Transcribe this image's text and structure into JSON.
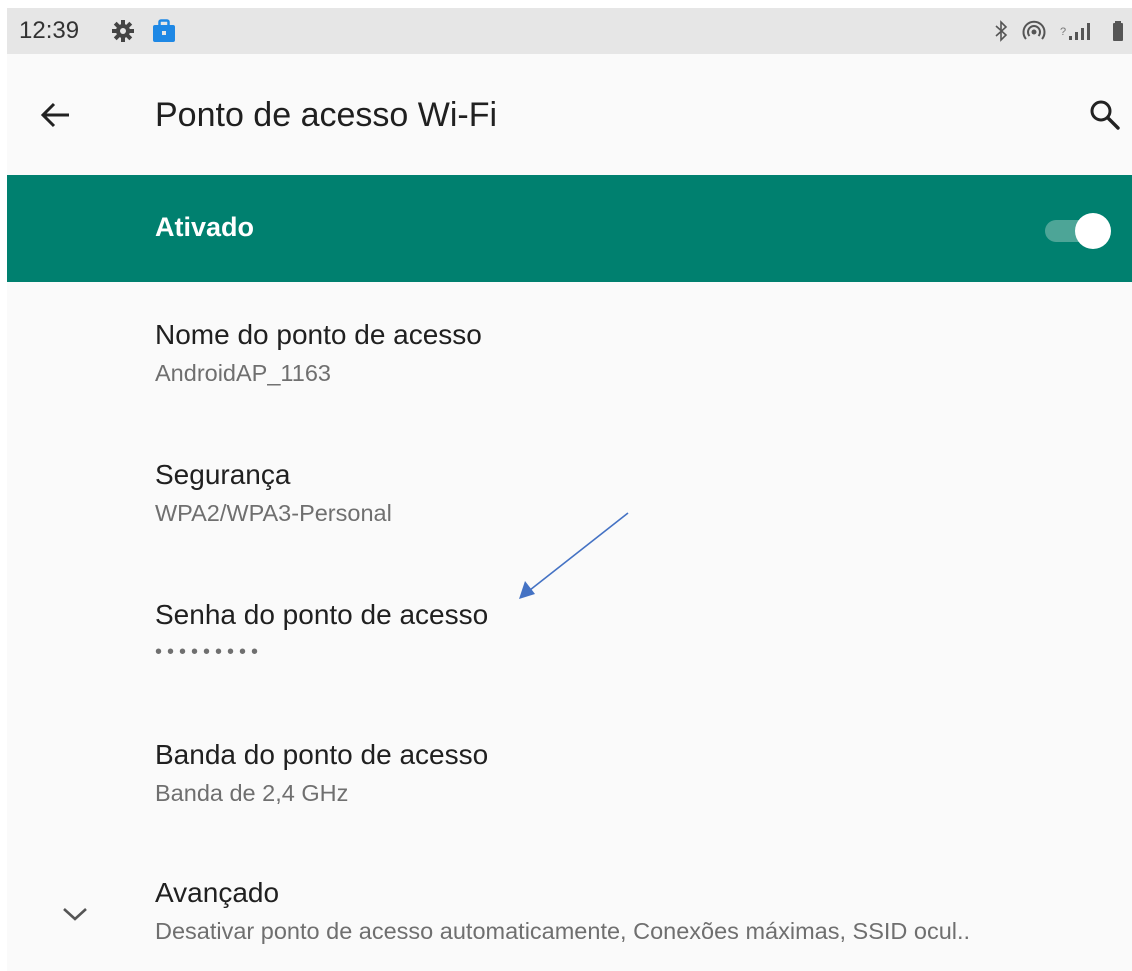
{
  "status_bar": {
    "time": "12:39",
    "left_icons": [
      "gear-icon",
      "work-bag-icon"
    ],
    "right_icons": [
      "bluetooth-icon",
      "hotspot-icon",
      "signal-icon",
      "battery-icon"
    ]
  },
  "toolbar": {
    "title": "Ponto de acesso Wi-Fi",
    "back_icon": "arrow-back-icon",
    "search_icon": "search-icon"
  },
  "master_switch": {
    "label": "Ativado",
    "state": true,
    "color": "#00806f"
  },
  "preferences": [
    {
      "title": "Nome do ponto de acesso",
      "summary": "AndroidAP_1163"
    },
    {
      "title": "Segurança",
      "summary": "WPA2/WPA3-Personal"
    },
    {
      "title": "Senha do ponto de acesso",
      "summary": "•••••••••"
    },
    {
      "title": "Banda do ponto de acesso",
      "summary": "Banda de 2,4 GHz"
    }
  ],
  "advanced": {
    "title": "Avançado",
    "summary": "Desativar ponto de acesso automaticamente,  Conexões máximas, SSID ocul..",
    "icon": "chevron-down-icon"
  },
  "annotation": {
    "color": "#4472c4"
  }
}
